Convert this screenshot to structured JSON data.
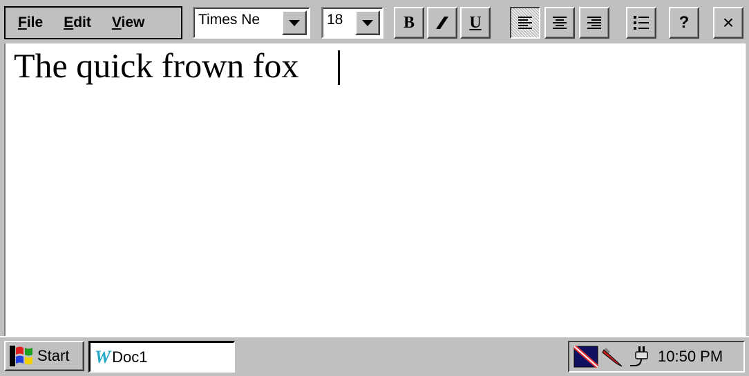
{
  "menu": {
    "file": {
      "first": "F",
      "rest": "ile"
    },
    "edit": {
      "first": "E",
      "rest": "dit"
    },
    "view": {
      "first": "V",
      "rest": "iew"
    }
  },
  "format": {
    "font_name": "Times Ne",
    "font_size": "18",
    "bold_label": "B",
    "italic_label": "I",
    "underline_label": "U",
    "help_label": "?",
    "close_label": "×",
    "alignment": "left"
  },
  "document": {
    "text": "The quick frown fox"
  },
  "taskbar": {
    "start_label": "Start",
    "task_label": "Doc1",
    "clock": "10:50 PM"
  },
  "colors": {
    "face": "#c0c0c0",
    "document_bg": "#ffffff",
    "word_icon": "#20a8c8"
  },
  "icons": [
    "windows-logo-icon",
    "word-w-icon",
    "network-icon",
    "pen-icon",
    "power-plug-icon",
    "dropdown-arrow-icon",
    "align-left-icon",
    "align-center-icon",
    "align-right-icon",
    "bullets-icon"
  ]
}
